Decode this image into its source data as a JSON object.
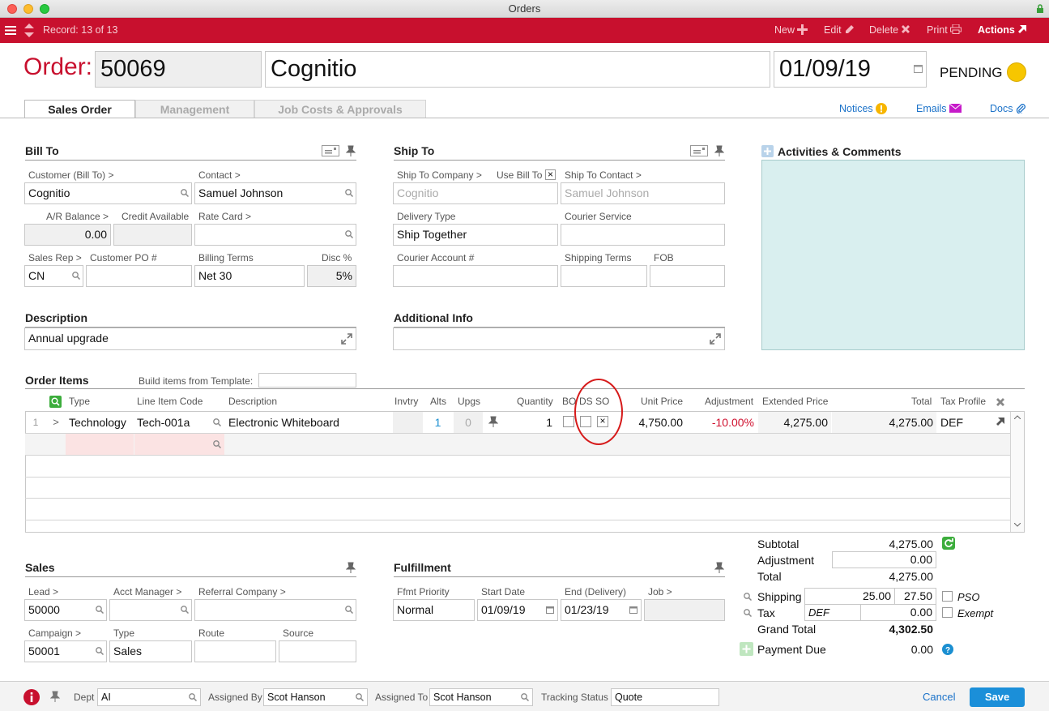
{
  "window": {
    "title": "Orders"
  },
  "toolbar": {
    "record": "Record: 13 of 13",
    "new": "New",
    "edit": "Edit",
    "delete": "Delete",
    "print": "Print",
    "actions": "Actions"
  },
  "header": {
    "order_label": "Order:",
    "order_number": "50069",
    "customer": "Cognitio",
    "date": "01/09/19",
    "status": "PENDING",
    "status_color": "#f7c600"
  },
  "tabs": [
    "Sales Order",
    "Management",
    "Job Costs & Approvals"
  ],
  "links": {
    "notices": "Notices",
    "emails": "Emails",
    "docs": "Docs"
  },
  "bill_to": {
    "title": "Bill To",
    "customer_label": "Customer (Bill To) >",
    "customer": "Cognitio",
    "contact_label": "Contact >",
    "contact": "Samuel Johnson",
    "ar_label": "A/R Balance >",
    "ar": "0.00",
    "credit_label": "Credit Available",
    "credit": "",
    "rate_label": "Rate Card >",
    "rate": "",
    "rep_label": "Sales Rep >",
    "rep": "CN",
    "po_label": "Customer PO #",
    "po": "",
    "terms_label": "Billing Terms",
    "terms": "Net 30",
    "disc_label": "Disc %",
    "disc": "5%"
  },
  "ship_to": {
    "title": "Ship To",
    "company_label": "Ship To Company >",
    "company": "Cognitio",
    "use_bill_label": "Use Bill To",
    "use_bill_checked": "×",
    "contact_label": "Ship To Contact >",
    "contact": "Samuel Johnson",
    "delivery_label": "Delivery Type",
    "delivery": "Ship Together",
    "courier_label": "Courier Service",
    "courier": "",
    "account_label": "Courier Account #",
    "account": "",
    "shipterms_label": "Shipping Terms",
    "shipterms": "",
    "fob_label": "FOB",
    "fob": ""
  },
  "activities": {
    "title": "Activities & Comments"
  },
  "description": {
    "title": "Description",
    "value": "Annual upgrade"
  },
  "additional": {
    "title": "Additional Info",
    "value": ""
  },
  "order_items": {
    "title": "Order Items",
    "template_label": "Build items from Template:",
    "columns": [
      "Type",
      "Line Item Code",
      "Description",
      "Invtry",
      "Alts",
      "Upgs",
      "Quantity",
      "BO",
      "DS",
      "SO",
      "Unit Price",
      "Adjustment",
      "Extended Price",
      "Total",
      "Tax Profile"
    ],
    "rows": [
      {
        "num": "1",
        "arrow": ">",
        "type": "Technology",
        "code": "Tech-001a",
        "desc": "Electronic Whiteboard",
        "alts": "1",
        "upgs": "0",
        "qty": "1",
        "so": "×",
        "unit": "4,750.00",
        "adj": "-10.00%",
        "ext": "4,275.00",
        "total": "4,275.00",
        "tax": "DEF"
      }
    ]
  },
  "sales": {
    "title": "Sales",
    "lead_label": "Lead >",
    "lead": "50000",
    "acct_label": "Acct Manager >",
    "acct": "",
    "ref_label": "Referral Company >",
    "ref": "",
    "campaign_label": "Campaign >",
    "campaign": "50001",
    "type_label": "Type",
    "type": "Sales",
    "route_label": "Route",
    "route": "",
    "source_label": "Source",
    "source": ""
  },
  "fulfillment": {
    "title": "Fulfillment",
    "priority_label": "Ffmt Priority",
    "priority": "Normal",
    "start_label": "Start Date",
    "start": "01/09/19",
    "end_label": "End (Delivery)",
    "end": "01/23/19",
    "job_label": "Job >",
    "job": ""
  },
  "totals": {
    "subtotal_label": "Subtotal",
    "subtotal": "4,275.00",
    "adjustment_label": "Adjustment",
    "adjustment": "0.00",
    "total_label": "Total",
    "total": "4,275.00",
    "shipping_label": "Shipping",
    "shipping_a": "25.00",
    "shipping_b": "27.50",
    "pso_label": "PSO",
    "tax_label": "Tax",
    "tax_profile": "DEF",
    "tax": "0.00",
    "exempt_label": "Exempt",
    "grand_label": "Grand Total",
    "grand": "4,302.50",
    "due_label": "Payment Due",
    "due": "0.00"
  },
  "footer": {
    "dept_label": "Dept",
    "dept": "AI",
    "assigned_by_label": "Assigned By",
    "assigned_by": "Scot Hanson",
    "assigned_to_label": "Assigned To",
    "assigned_to": "Scot Hanson",
    "tracking_label": "Tracking Status",
    "tracking": "Quote",
    "cancel": "Cancel",
    "save": "Save"
  }
}
